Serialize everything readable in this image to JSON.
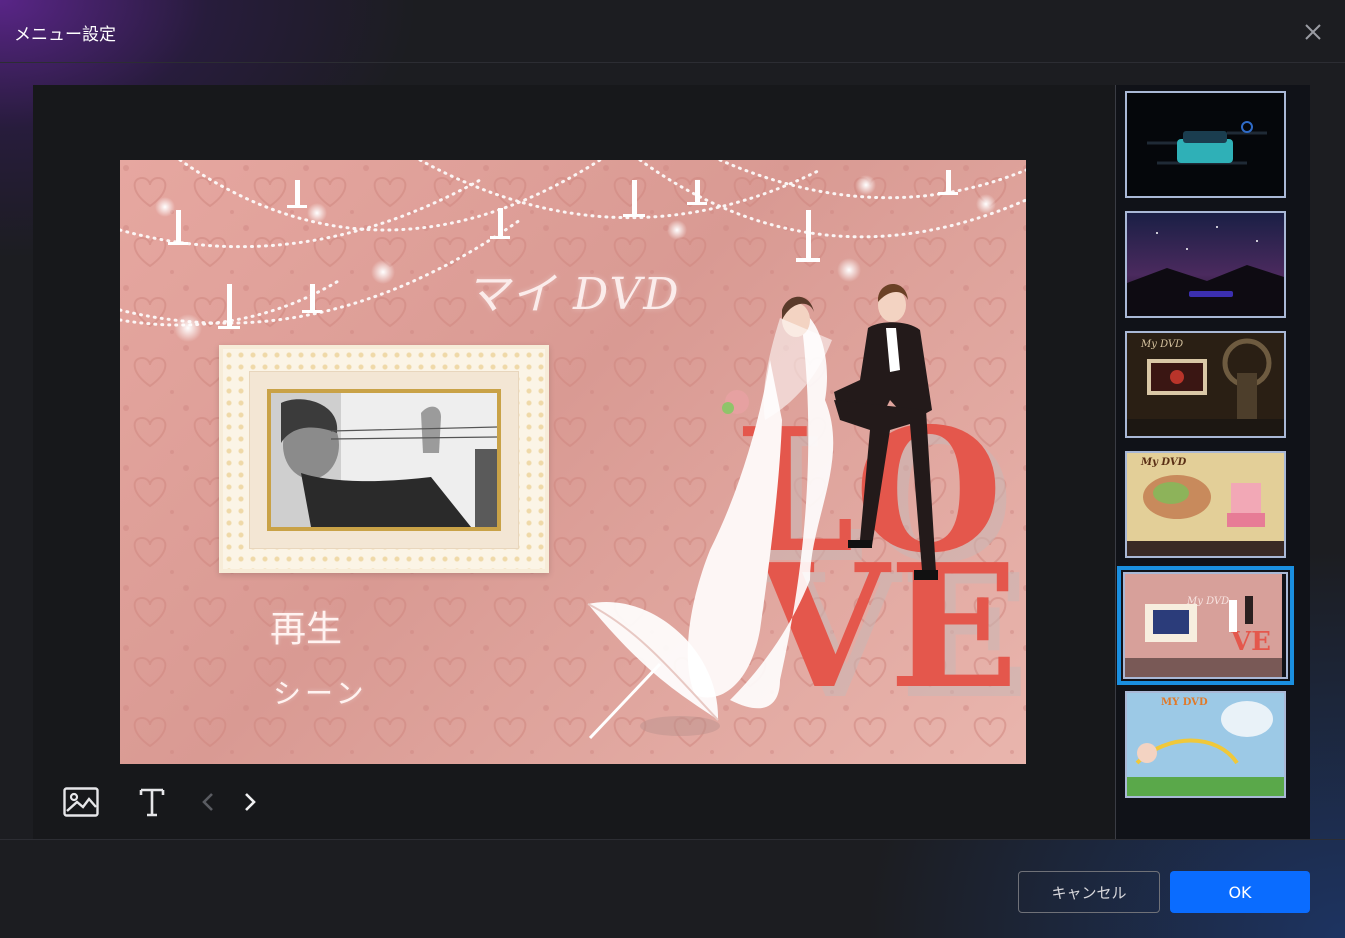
{
  "window": {
    "title": "メニュー設定"
  },
  "canvas": {
    "title": "マイ DVD",
    "play_label": "再生",
    "scene_label": "シーン",
    "decor_text": "LOVE"
  },
  "thumbnails": [
    {
      "name": "tech-dark-template",
      "selected": false,
      "label": ""
    },
    {
      "name": "night-sky-template",
      "selected": false,
      "label": ""
    },
    {
      "name": "film-reel-template",
      "selected": false,
      "label": "My DVD"
    },
    {
      "name": "birthday-template",
      "selected": false,
      "label": "My DVD"
    },
    {
      "name": "wedding-love-template",
      "selected": true,
      "label": "My DVD"
    },
    {
      "name": "kids-cartoon-template",
      "selected": false,
      "label": "MY DVD"
    }
  ],
  "toolbar": {
    "icons": [
      "image-icon",
      "text-icon",
      "chevron-left-icon",
      "chevron-right-icon"
    ]
  },
  "footer": {
    "cancel_label": "キャンセル",
    "ok_label": "OK"
  },
  "colors": {
    "accent": "#0a6cff",
    "selected_border": "#1a8fe0",
    "background": "#1c1d21"
  }
}
